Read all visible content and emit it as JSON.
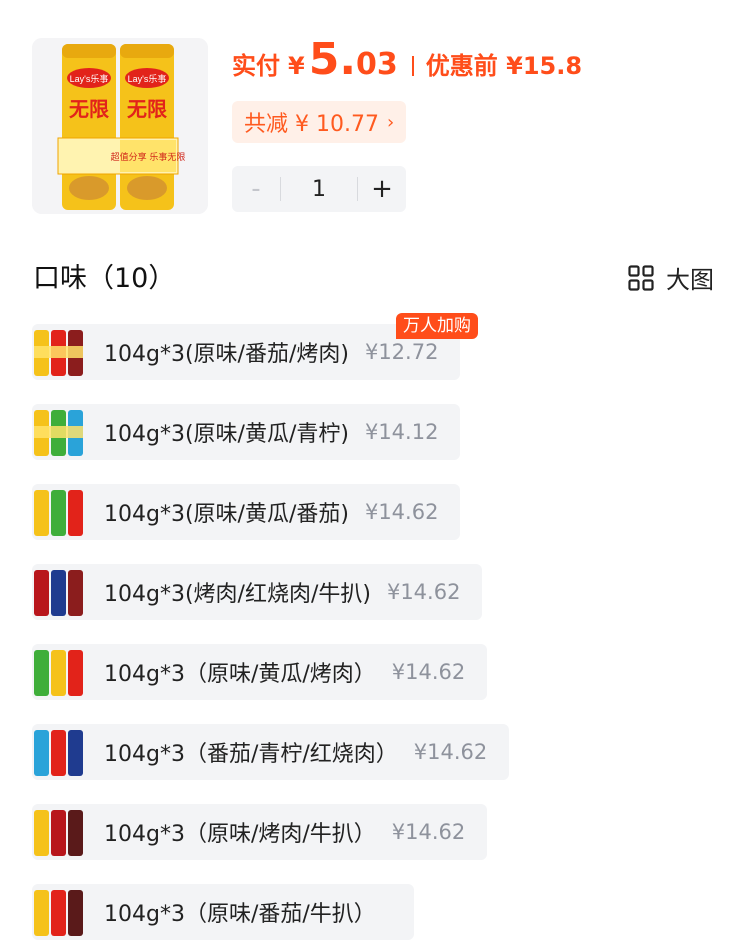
{
  "product": {
    "pack_text_1": "Lay's乐事",
    "pack_text_2": "无限",
    "pack_promo": "超值分享 乐事无限"
  },
  "price": {
    "paid_label": "实付",
    "currency": "¥",
    "amount_int": "5.",
    "amount_dec": "03",
    "before_label": "优惠前 ¥15.8"
  },
  "discount": {
    "label": "共减 ¥ 10.77",
    "chevron": "›"
  },
  "stepper": {
    "minus": "-",
    "value": "1",
    "plus": "+"
  },
  "flavors": {
    "title": "口味（10）",
    "view_toggle": "大图",
    "hot_tag": "万人加购",
    "options": [
      {
        "name": "104g*3(原味/番茄/烤肉)",
        "price": "¥12.72"
      },
      {
        "name": "104g*3(原味/黄瓜/青柠)",
        "price": "¥14.12"
      },
      {
        "name": "104g*3(原味/黄瓜/番茄)",
        "price": "¥14.62"
      },
      {
        "name": "104g*3(烤肉/红烧肉/牛扒)",
        "price": "¥14.62"
      },
      {
        "name": "104g*3（原味/黄瓜/烤肉）",
        "price": "¥14.62"
      },
      {
        "name": "104g*3（番茄/青柠/红烧肉）",
        "price": "¥14.62"
      },
      {
        "name": "104g*3（原味/烤肉/牛扒）",
        "price": "¥14.62"
      },
      {
        "name": "104g*3（原味/番茄/牛扒）",
        "price": ""
      }
    ]
  },
  "colors": {
    "accent": "#ff4d1a",
    "chip_bg": "#fff0e8",
    "option_bg": "#f3f4f6",
    "price_gray": "#8e929c"
  },
  "icons": {
    "view_toggle": "grid-icon",
    "discount_more": "chevron-right-icon"
  }
}
